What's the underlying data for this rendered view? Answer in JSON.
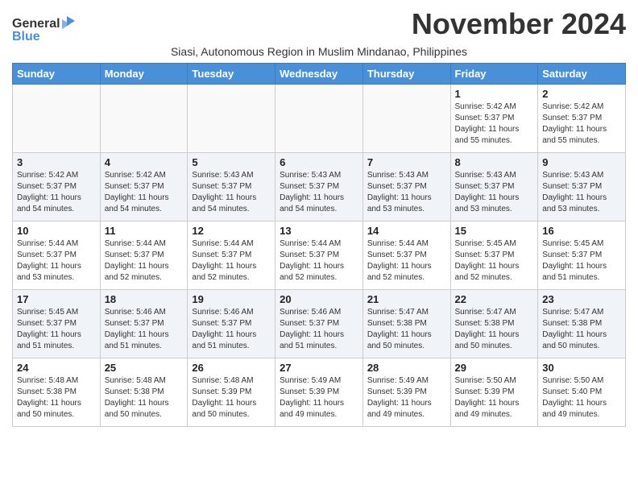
{
  "logo": {
    "line1": "General",
    "line2": "Blue"
  },
  "title": "November 2024",
  "subtitle": "Siasi, Autonomous Region in Muslim Mindanao, Philippines",
  "headers": [
    "Sunday",
    "Monday",
    "Tuesday",
    "Wednesday",
    "Thursday",
    "Friday",
    "Saturday"
  ],
  "weeks": [
    [
      {
        "day": "",
        "info": ""
      },
      {
        "day": "",
        "info": ""
      },
      {
        "day": "",
        "info": ""
      },
      {
        "day": "",
        "info": ""
      },
      {
        "day": "",
        "info": ""
      },
      {
        "day": "1",
        "info": "Sunrise: 5:42 AM\nSunset: 5:37 PM\nDaylight: 11 hours\nand 55 minutes."
      },
      {
        "day": "2",
        "info": "Sunrise: 5:42 AM\nSunset: 5:37 PM\nDaylight: 11 hours\nand 55 minutes."
      }
    ],
    [
      {
        "day": "3",
        "info": "Sunrise: 5:42 AM\nSunset: 5:37 PM\nDaylight: 11 hours\nand 54 minutes."
      },
      {
        "day": "4",
        "info": "Sunrise: 5:42 AM\nSunset: 5:37 PM\nDaylight: 11 hours\nand 54 minutes."
      },
      {
        "day": "5",
        "info": "Sunrise: 5:43 AM\nSunset: 5:37 PM\nDaylight: 11 hours\nand 54 minutes."
      },
      {
        "day": "6",
        "info": "Sunrise: 5:43 AM\nSunset: 5:37 PM\nDaylight: 11 hours\nand 54 minutes."
      },
      {
        "day": "7",
        "info": "Sunrise: 5:43 AM\nSunset: 5:37 PM\nDaylight: 11 hours\nand 53 minutes."
      },
      {
        "day": "8",
        "info": "Sunrise: 5:43 AM\nSunset: 5:37 PM\nDaylight: 11 hours\nand 53 minutes."
      },
      {
        "day": "9",
        "info": "Sunrise: 5:43 AM\nSunset: 5:37 PM\nDaylight: 11 hours\nand 53 minutes."
      }
    ],
    [
      {
        "day": "10",
        "info": "Sunrise: 5:44 AM\nSunset: 5:37 PM\nDaylight: 11 hours\nand 53 minutes."
      },
      {
        "day": "11",
        "info": "Sunrise: 5:44 AM\nSunset: 5:37 PM\nDaylight: 11 hours\nand 52 minutes."
      },
      {
        "day": "12",
        "info": "Sunrise: 5:44 AM\nSunset: 5:37 PM\nDaylight: 11 hours\nand 52 minutes."
      },
      {
        "day": "13",
        "info": "Sunrise: 5:44 AM\nSunset: 5:37 PM\nDaylight: 11 hours\nand 52 minutes."
      },
      {
        "day": "14",
        "info": "Sunrise: 5:44 AM\nSunset: 5:37 PM\nDaylight: 11 hours\nand 52 minutes."
      },
      {
        "day": "15",
        "info": "Sunrise: 5:45 AM\nSunset: 5:37 PM\nDaylight: 11 hours\nand 52 minutes."
      },
      {
        "day": "16",
        "info": "Sunrise: 5:45 AM\nSunset: 5:37 PM\nDaylight: 11 hours\nand 51 minutes."
      }
    ],
    [
      {
        "day": "17",
        "info": "Sunrise: 5:45 AM\nSunset: 5:37 PM\nDaylight: 11 hours\nand 51 minutes."
      },
      {
        "day": "18",
        "info": "Sunrise: 5:46 AM\nSunset: 5:37 PM\nDaylight: 11 hours\nand 51 minutes."
      },
      {
        "day": "19",
        "info": "Sunrise: 5:46 AM\nSunset: 5:37 PM\nDaylight: 11 hours\nand 51 minutes."
      },
      {
        "day": "20",
        "info": "Sunrise: 5:46 AM\nSunset: 5:37 PM\nDaylight: 11 hours\nand 51 minutes."
      },
      {
        "day": "21",
        "info": "Sunrise: 5:47 AM\nSunset: 5:38 PM\nDaylight: 11 hours\nand 50 minutes."
      },
      {
        "day": "22",
        "info": "Sunrise: 5:47 AM\nSunset: 5:38 PM\nDaylight: 11 hours\nand 50 minutes."
      },
      {
        "day": "23",
        "info": "Sunrise: 5:47 AM\nSunset: 5:38 PM\nDaylight: 11 hours\nand 50 minutes."
      }
    ],
    [
      {
        "day": "24",
        "info": "Sunrise: 5:48 AM\nSunset: 5:38 PM\nDaylight: 11 hours\nand 50 minutes."
      },
      {
        "day": "25",
        "info": "Sunrise: 5:48 AM\nSunset: 5:38 PM\nDaylight: 11 hours\nand 50 minutes."
      },
      {
        "day": "26",
        "info": "Sunrise: 5:48 AM\nSunset: 5:39 PM\nDaylight: 11 hours\nand 50 minutes."
      },
      {
        "day": "27",
        "info": "Sunrise: 5:49 AM\nSunset: 5:39 PM\nDaylight: 11 hours\nand 49 minutes."
      },
      {
        "day": "28",
        "info": "Sunrise: 5:49 AM\nSunset: 5:39 PM\nDaylight: 11 hours\nand 49 minutes."
      },
      {
        "day": "29",
        "info": "Sunrise: 5:50 AM\nSunset: 5:39 PM\nDaylight: 11 hours\nand 49 minutes."
      },
      {
        "day": "30",
        "info": "Sunrise: 5:50 AM\nSunset: 5:40 PM\nDaylight: 11 hours\nand 49 minutes."
      }
    ]
  ]
}
